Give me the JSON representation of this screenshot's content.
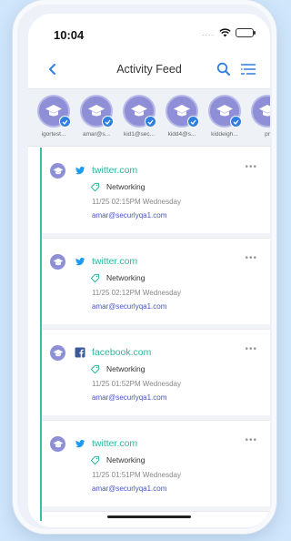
{
  "status": {
    "time": "10:04"
  },
  "header": {
    "title": "Activity Feed"
  },
  "kids": [
    {
      "name": "igortest..."
    },
    {
      "name": "amar@s..."
    },
    {
      "name": "kid1@sec..."
    },
    {
      "name": "kidd4@s..."
    },
    {
      "name": "kiddeigh..."
    },
    {
      "name": "pr"
    }
  ],
  "feed": [
    {
      "site": "twitter.com",
      "site_icon": "twitter-icon",
      "category": "Networking",
      "time": "11/25 02:15PM Wednesday",
      "email": "amar@securlyqa1.com"
    },
    {
      "site": "twitter.com",
      "site_icon": "twitter-icon",
      "category": "Networking",
      "time": "11/25 02:12PM Wednesday",
      "email": "amar@securlyqa1.com"
    },
    {
      "site": "facebook.com",
      "site_icon": "facebook-icon",
      "category": "Networking",
      "time": "11/25 01:52PM Wednesday",
      "email": "amar@securlyqa1.com"
    },
    {
      "site": "twitter.com",
      "site_icon": "twitter-icon",
      "category": "Networking",
      "time": "11/25 01:51PM Wednesday",
      "email": "amar@securlyqa1.com"
    }
  ],
  "colors": {
    "accent": "#2f7fe0",
    "site_text": "#2fb5a1",
    "avatar": "#8e8fd6",
    "email": "#4a56c2",
    "timeline": "#37c0a8"
  }
}
